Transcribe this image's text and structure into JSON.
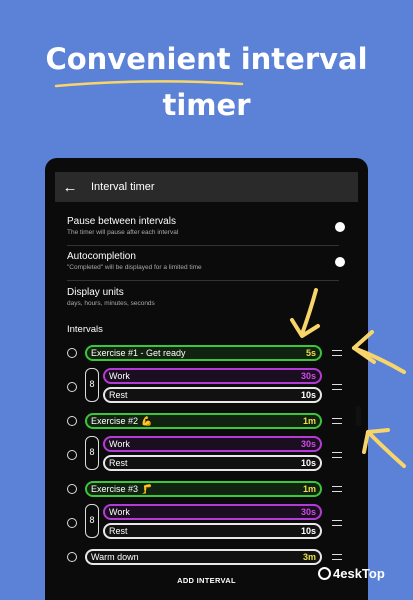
{
  "headline": {
    "line1": "Convenient interval",
    "line2": "timer"
  },
  "appbar": {
    "back_icon": "←",
    "title": "Interval timer"
  },
  "settings": [
    {
      "title": "Pause between intervals",
      "subtitle": "The timer will pause after each interval",
      "toggle_on": true
    },
    {
      "title": "Autocompletion",
      "subtitle": "\"Completed\" will be displayed for a limited time",
      "toggle_on": true
    },
    {
      "title": "Display units",
      "subtitle": "days, hours, minutes, seconds"
    }
  ],
  "intervals_label": "Intervals",
  "intervals": [
    {
      "name": "Exercise #1 - Get ready",
      "duration": "5s",
      "emoji": ""
    },
    {
      "repeat": "8",
      "work": {
        "name": "Work",
        "duration": "30s"
      },
      "rest": {
        "name": "Rest",
        "duration": "10s"
      }
    },
    {
      "name": "Exercise #2",
      "duration": "1m",
      "emoji": "💪"
    },
    {
      "repeat": "8",
      "work": {
        "name": "Work",
        "duration": "30s"
      },
      "rest": {
        "name": "Rest",
        "duration": "10s"
      }
    },
    {
      "name": "Exercise #3",
      "duration": "1m",
      "emoji": "🦵"
    },
    {
      "repeat": "8",
      "work": {
        "name": "Work",
        "duration": "30s"
      },
      "rest": {
        "name": "Rest",
        "duration": "10s"
      }
    },
    {
      "name": "Warm down",
      "duration": "3m",
      "emoji": ""
    }
  ],
  "add_interval_label": "ADD INTERVAL",
  "watermark": "4eskTop",
  "colors": {
    "background": "#5b82d6",
    "green": "#3ac83a",
    "purple": "#b53bd6",
    "yellow": "#e7e04a",
    "arrow": "#f7d56b"
  }
}
